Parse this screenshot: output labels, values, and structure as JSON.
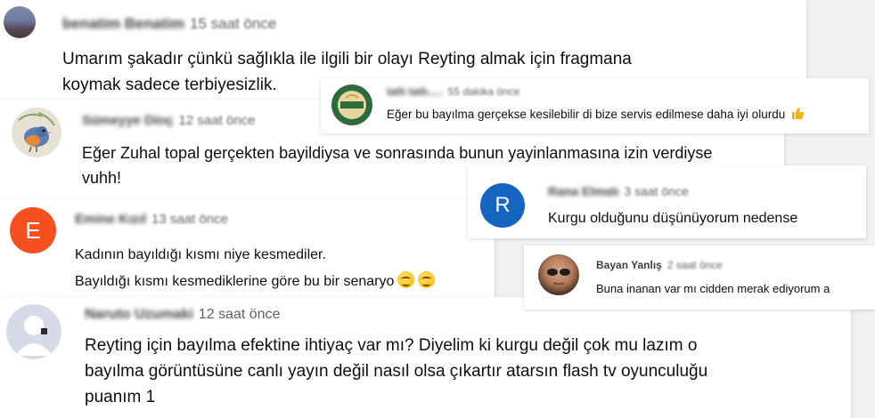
{
  "comments": [
    {
      "author": "benatim Benatim",
      "time": "15 saat önce",
      "text_lines": [
        "Umarım şakadır çünkü sağlıkla ile ilgili bir olayı Reyting almak için fragmana",
        "koymak sadece terbiyesizlik."
      ],
      "avatar": "landscape-photo-avatar"
    },
    {
      "author": "tatlı tatlı.....",
      "time": "55 dakika önce",
      "text_lines": [
        "Eğer bu bayılma gerçekse kesilebilir di bize servis edilmese daha iyi olurdu"
      ],
      "emoji": "thumbs-up-icon",
      "avatar": "green-logo-avatar"
    },
    {
      "author": "Sümeyye Dinç",
      "time": "12 saat önce",
      "text_lines": [
        "Eğer Zuhal topal gerçekten bayildiysa ve sonrasında bunun yayinlanmasına izin verdiyse",
        "vuhh!"
      ],
      "avatar": "bird-illustration-avatar"
    },
    {
      "author": "Rana Elmalı",
      "time": "3 saat önce",
      "initial": "R",
      "text_lines": [
        "Kurgu olduğunu düşünüyorum nedense"
      ],
      "avatar_color": "#1565c0"
    },
    {
      "author": "Emine Kızıl",
      "time": "13 saat önce",
      "initial": "E",
      "text_lines": [
        "Kadının bayıldığı kısmı niye kesmediler.",
        "Bayıldığı kısmı kesmediklerine göre bu bir senaryo"
      ],
      "emoji_count": 2,
      "avatar_color": "#f4511e"
    },
    {
      "author": "Bayan Yanlış",
      "time": "2 saat önce",
      "text_lines": [
        "Buna inanan var mı cidden merak ediyorum a"
      ],
      "avatar": "woman-sunglasses-avatar"
    },
    {
      "author": "Naruto Uzumaki",
      "time": "12 saat önce",
      "text_lines": [
        "Reyting için bayılma efektine ihtiyaç var mı? Diyelim ki kurgu değil çok mu lazım o",
        "bayılma görüntüsüne canlı yayın değil nasıl olsa çıkartır atarsın flash tv oyunculuğu",
        "puanım 1"
      ],
      "avatar": "default-user-avatar"
    }
  ],
  "colors": {
    "background": "#f1f1f1",
    "card": "#ffffff",
    "text": "#0f0f0f",
    "meta": "#606060"
  }
}
